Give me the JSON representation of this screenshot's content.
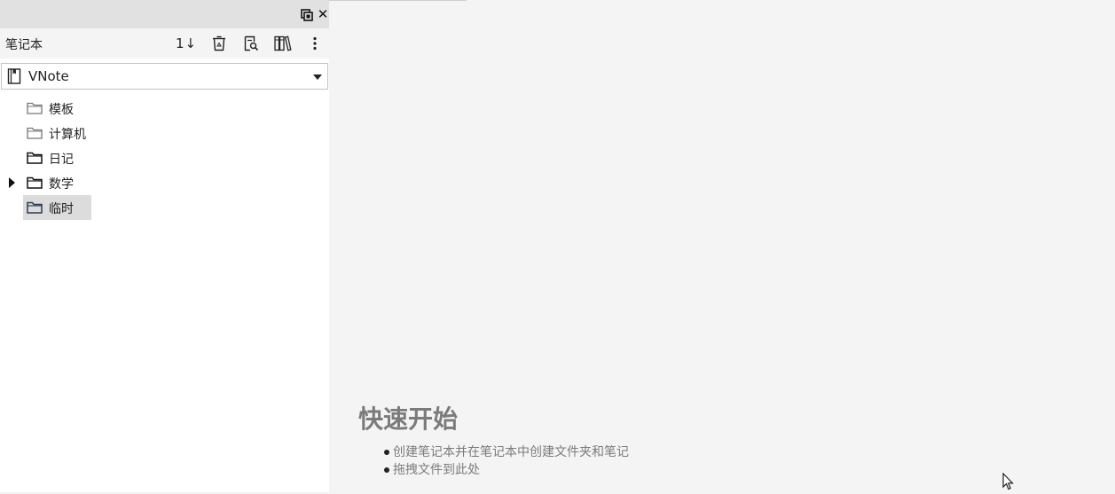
{
  "dock": {
    "title": "笔记本",
    "float_icon": "float-window-icon",
    "close_glyph": "✕",
    "toolbar": {
      "sort_label": "1↓",
      "buttons": [
        "sort-icon",
        "recycle-bin-icon",
        "search-notes-icon",
        "library-icon",
        "more-options-icon"
      ]
    },
    "notebook_select": {
      "value": "VNote",
      "icon": "notebook-icon"
    },
    "tree": [
      {
        "label": "模板",
        "has_children": false,
        "selected": false
      },
      {
        "label": "计算机",
        "has_children": false,
        "selected": false
      },
      {
        "label": "日记",
        "has_children": false,
        "selected": false
      },
      {
        "label": "数学",
        "has_children": true,
        "selected": false
      },
      {
        "label": "临时",
        "has_children": false,
        "selected": true
      }
    ]
  },
  "welcome": {
    "title": "快速开始",
    "items": [
      "创建笔记本并在笔记本中创建文件夹和笔记",
      "拖拽文件到此处"
    ]
  },
  "colors": {
    "dock_titlebar": "#e1e1e1",
    "background": "#f4f4f4",
    "selected_item": "#dcdcdc",
    "welcome_text": "#7b7b7b"
  }
}
